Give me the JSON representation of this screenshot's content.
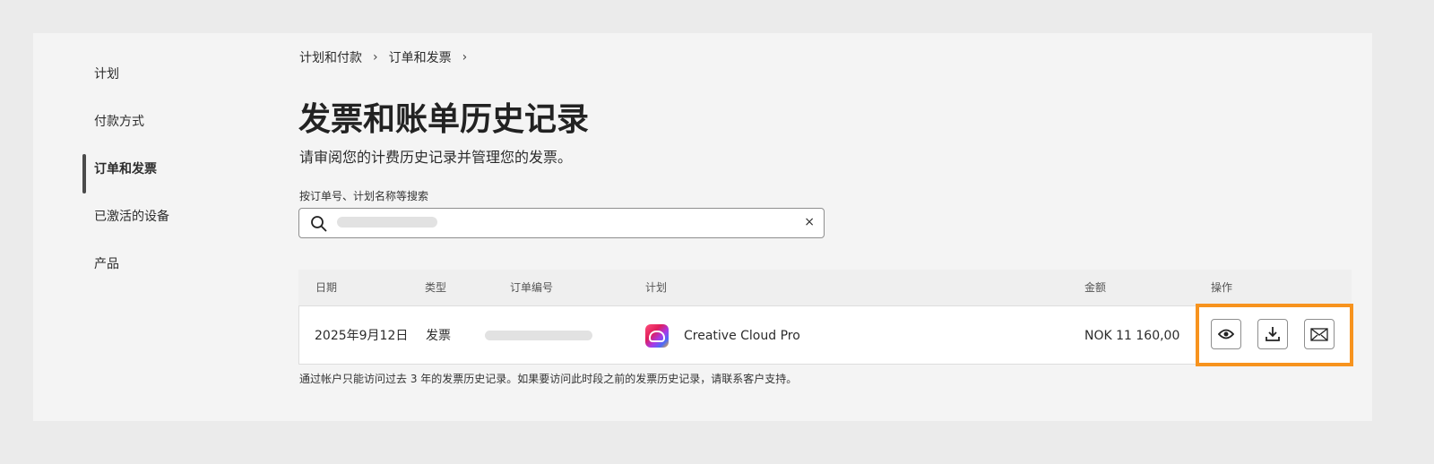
{
  "sidebar": {
    "items": [
      {
        "label": "计划"
      },
      {
        "label": "付款方式"
      },
      {
        "label": "订单和发票"
      },
      {
        "label": "已激活的设备"
      },
      {
        "label": "产品"
      }
    ]
  },
  "breadcrumb": [
    "计划和付款",
    "订单和发票"
  ],
  "page": {
    "title": "发票和账单历史记录",
    "subtitle": "请审阅您的计费历史记录并管理您的发票。"
  },
  "search": {
    "label": "按订单号、计划名称等搜索",
    "clear": "×"
  },
  "table": {
    "headers": {
      "date": "日期",
      "type": "类型",
      "order": "订单编号",
      "plan": "计划",
      "amount": "金额",
      "actions": "操作"
    },
    "rows": [
      {
        "date": "2025年9月12日",
        "type": "发票",
        "plan": "Creative Cloud Pro",
        "amount": "NOK 11 160,00"
      }
    ]
  },
  "note": "通过帐户只能访问过去 3 年的发票历史记录。如果要访问此时段之前的发票历史记录，请联系客户支持。",
  "colors": {
    "highlight": "#f7931e"
  }
}
